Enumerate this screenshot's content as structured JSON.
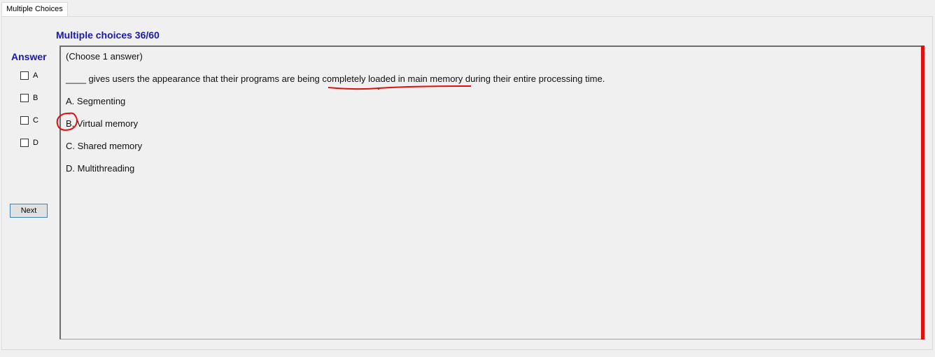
{
  "tab": {
    "label": "Multiple Choices"
  },
  "header": {
    "title": "Multiple choices 36/60"
  },
  "answer_panel": {
    "title": "Answer",
    "options": [
      {
        "label": "A",
        "checked": false
      },
      {
        "label": "B",
        "checked": false
      },
      {
        "label": "C",
        "checked": false
      },
      {
        "label": "D",
        "checked": false
      }
    ],
    "next_label": "Next"
  },
  "question": {
    "instruction": "(Choose 1 answer)",
    "stem": "____ gives users the appearance that their programs are being completely loaded in main memory during their entire processing time.",
    "choices": [
      "A.  Segmenting",
      "B.  Virtual memory",
      "C.  Shared memory",
      "D.  Multithreading"
    ]
  },
  "annotation_color": "#e01010"
}
